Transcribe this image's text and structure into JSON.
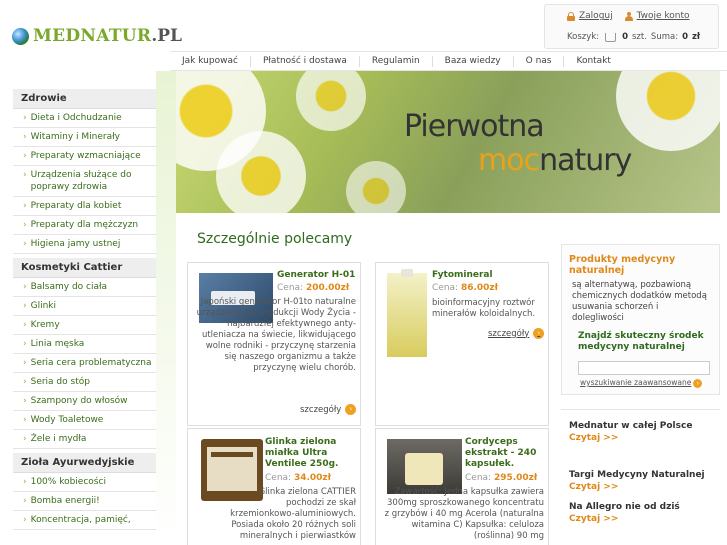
{
  "logo": {
    "text_a": "MEDNATUR",
    "text_b": ".PL"
  },
  "user": {
    "login": "Zaloguj",
    "account": "Twoje konto",
    "cart_label": "Koszyk:",
    "cart_count": "0",
    "cart_units": "szt.",
    "sum_label": "Suma:",
    "sum_value": "0",
    "currency": "zł"
  },
  "nav": [
    "Jak kupować",
    "Płatność i dostawa",
    "Regulamin",
    "Baza wiedzy",
    "O nas",
    "Kontakt"
  ],
  "sidebar": {
    "cat1": "Zdrowie",
    "items1": [
      "Dieta i Odchudzanie",
      "Witaminy i Minerały",
      "Preparaty wzmacniające",
      "Urządzenia służące do poprawy zdrowia",
      "Preparaty dla kobiet",
      "Preparaty dla mężczyzn",
      "Higiena jamy ustnej"
    ],
    "cat2": "Kosmetyki Cattier",
    "items2": [
      "Balsamy do ciała",
      "Glinki",
      "Kremy",
      "Linia męska",
      "Seria cera problematyczna",
      "Seria do stóp",
      "Szampony do włosów",
      "Wody Toaletowe",
      "Żele i mydła"
    ],
    "cat3": "Zioła Ayurwedyjskie",
    "items3": [
      "100% kobiecości",
      "Bomba energii!",
      "Koncentracja, pamięć,"
    ]
  },
  "banner": {
    "line1": "Pierwotna",
    "moc": "moc",
    "natury": "natury"
  },
  "main": {
    "heading": "Szczególnie polecamy",
    "products": [
      {
        "title": "Generator H-01",
        "price_label": "Cena:",
        "price": "200.00zł",
        "desc": "Japoński generator H-01to naturalne urządzenie do produkcji Wody Życia - najbardziej efektywnego anty-utleniacza na świecie, likwidującego wolne rodniki - przyczynę starzenia się naszego organizmu a także przyczynę wielu chorób.",
        "more": "szczegóły"
      },
      {
        "title": "Fytomineral",
        "price_label": "Cena:",
        "price": "86.00zł",
        "desc": "bioinformacyjny roztwór minerałów koloidalnych.",
        "more": "szczegóły"
      },
      {
        "title": "Glinka zielona miałka Ultra Ventilee 250g.",
        "price_label": "Cena:",
        "price": "34.00zł",
        "desc": "Glinka zielona CATTIER pochodzi ze skał krzemionkowo-aluminiowych. Posiada około 20 różnych soli mineralnych i pierwiastków"
      },
      {
        "title": "Cordyceps ekstrakt - 240 kapsułek.",
        "price_label": "Cena:",
        "price": "295.00zł",
        "desc": "Zawartość: Jedna kapsułka zawiera 300mg sproszkowanego koncentratu z grzybów i 40 mg Acerola (naturalna witamina C) Kapsułka: celuloza (roślinna) 90 mg"
      }
    ]
  },
  "right": {
    "title": "Produkty medycyny naturalnej",
    "desc": "są alternatywą, pozbawioną chemicznych dodatków metodą usuwania schorzeń i dolegliwości",
    "find": "Znajdź skuteczny środek medycyny naturalnej",
    "search_placeholder": "",
    "advanced": "wyszukiwanie zaawansowane",
    "news": [
      {
        "title": "Mednatur w całej Polsce",
        "more": "Czytaj >>"
      },
      {
        "title": "Targi Medycyny Naturalnej",
        "more": "Czytaj >>"
      },
      {
        "title": "Na Allegro nie od dziś",
        "more": "Czytaj >>"
      }
    ]
  },
  "colors": {
    "green": "#3a6d1a",
    "orange": "#e0891a",
    "accent": "#8bb33d"
  }
}
